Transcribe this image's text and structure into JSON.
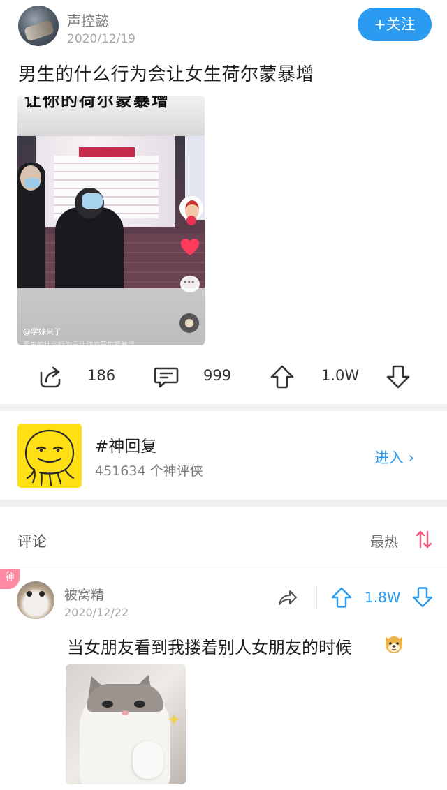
{
  "post": {
    "author": "声控懿",
    "date": "2020/12/19",
    "follow_label": "+关注",
    "title": "男生的什么行为会让女生荷尔蒙暴增",
    "video": {
      "banner_text": "让你的荷尔蒙暴增",
      "caption": "@学妹来了",
      "caption_line2": "男生的什么行为会让你的荷尔蒙暴增"
    },
    "actions": {
      "share_count": "186",
      "comment_count": "999",
      "upvote_count": "1.0W"
    }
  },
  "topic": {
    "name": "#神回复",
    "count_text": "451634 个神评侠",
    "enter_label": "进入 ›"
  },
  "comments": {
    "label": "评论",
    "sort_label": "最热",
    "items": [
      {
        "badge": "神",
        "name": "被窝精",
        "date": "2020/12/22",
        "upvotes": "1.8W",
        "text": "当女朋友看到我搂着别人女朋友的时候"
      }
    ]
  },
  "colors": {
    "accent": "#2a9bf0",
    "badge": "#ff8aa3",
    "topic_icon": "#ffe014",
    "sort_up": "#2a9bf0",
    "sort_down": "#ef5a7a"
  },
  "icons": {
    "share": "share-arrow-icon",
    "comment": "comment-bubble-icon",
    "upvote": "thumb-up-arrow-icon",
    "downvote": "thumb-down-arrow-icon",
    "sort": "sort-arrows-icon",
    "emoji": "dog-face-emoji-icon"
  }
}
